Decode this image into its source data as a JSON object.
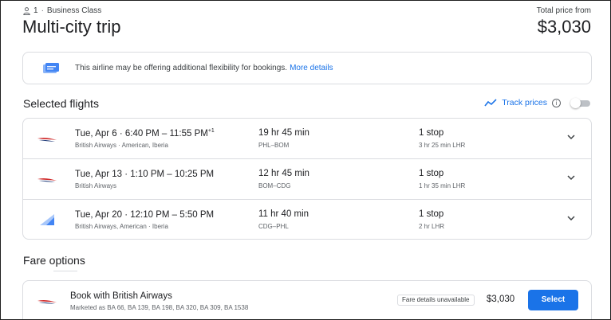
{
  "header": {
    "passenger_count": "1",
    "cabin_class": "Business Class",
    "trip_title": "Multi-city trip",
    "total_label": "Total price from",
    "total_price": "$3,030"
  },
  "notice": {
    "text": "This airline may be offering additional flexibility for bookings.",
    "link": "More details"
  },
  "selected_flights": {
    "title": "Selected flights",
    "track_prices_label": "Track prices",
    "info_glyph": "i",
    "track_toggle_on": false,
    "flights": [
      {
        "logo_icon": "british-airways-logo",
        "date_time": "Tue, Apr 6  ·  6:40 PM – 11:55 PM",
        "day_offset": "+1",
        "airlines": "British Airways · American, Iberia",
        "duration": "19 hr 45 min",
        "route": "PHL–BOM",
        "stops": "1 stop",
        "layover": "3 hr 25 min LHR"
      },
      {
        "logo_icon": "british-airways-logo",
        "date_time": "Tue, Apr 13  ·  1:10 PM – 10:25 PM",
        "day_offset": "",
        "airlines": "British Airways",
        "duration": "12 hr 45 min",
        "route": "BOM–CDG",
        "stops": "1 stop",
        "layover": "1 hr 35 min LHR"
      },
      {
        "logo_icon": "multi-airline-logo",
        "date_time": "Tue, Apr 20  ·  12:10 PM – 5:50 PM",
        "day_offset": "",
        "airlines": "British Airways, American · Iberia",
        "duration": "11 hr 40 min",
        "route": "CDG–PHL",
        "stops": "1 stop",
        "layover": "2 hr LHR"
      }
    ]
  },
  "fare_options": {
    "title": "Fare options",
    "options": [
      {
        "logo_icon": "british-airways-logo",
        "book_with": "Book with British Airways",
        "marketed_as": "Marketed as BA 66, BA 139, BA 198, BA 320, BA 309, BA 1538",
        "badge": "Fare details unavailable",
        "price": "$3,030",
        "select_label": "Select"
      }
    ]
  },
  "colors": {
    "accent": "#1a73e8",
    "border": "#dadce0",
    "ba_red": "#d12d2d",
    "ba_blue": "#1e3a78"
  }
}
